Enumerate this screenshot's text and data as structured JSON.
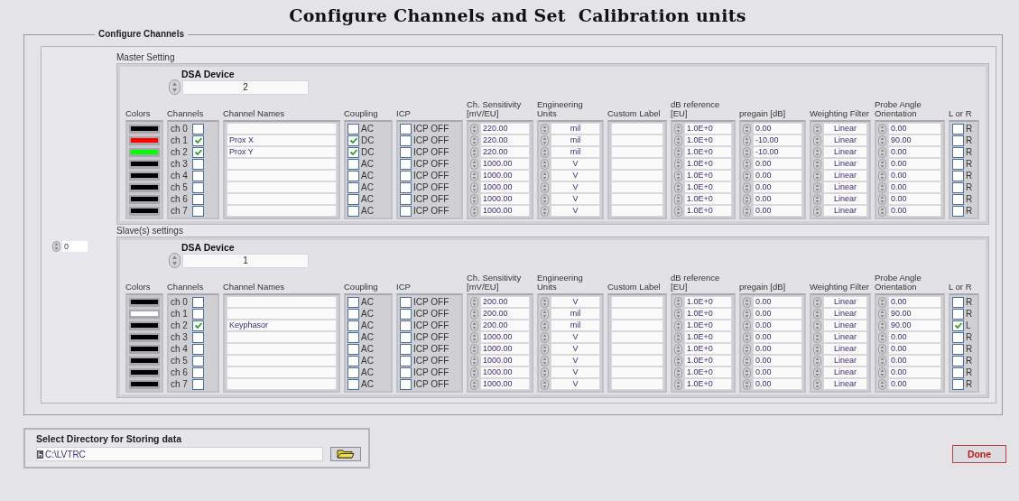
{
  "title": "Configure Channels and Set  Calibration units",
  "frame_label": "Configure Channels",
  "sections": [
    {
      "label": "Master Setting",
      "device_label": "DSA Device",
      "device": "2",
      "columns": [
        {
          "label": "Colors",
          "kind": "color"
        },
        {
          "label": "Channels",
          "kind": "channel"
        },
        {
          "label": "Channel Names",
          "kind": "name"
        },
        {
          "label": "Coupling",
          "kind": "coupling"
        },
        {
          "label": "ICP",
          "kind": "icp"
        },
        {
          "label": "Ch. Sensitivity [mV/EU]",
          "kind": "sensitivity"
        },
        {
          "label": "Engineering Units",
          "kind": "units"
        },
        {
          "label": "Custom Label",
          "kind": "custom"
        },
        {
          "label": "dB reference [EU]",
          "kind": "db_ref"
        },
        {
          "label": "pregain [dB]",
          "kind": "pregain"
        },
        {
          "label": "Weighting Filter",
          "kind": "filter"
        },
        {
          "label": "Probe Angle Orientation",
          "kind": "angle"
        },
        {
          "label": "L or R",
          "kind": "side"
        }
      ],
      "rows": [
        {
          "color": "#000000",
          "channel": "ch 0",
          "enabled": false,
          "coupling": {
            "checked": false,
            "label": "AC"
          },
          "icp": {
            "checked": false,
            "label": "ICP OFF"
          },
          "sensitivity": "220.00",
          "units": "mil",
          "db_ref": "1.0E+0",
          "pregain": "0.00",
          "filter": "Linear",
          "angle": "0.00",
          "side": {
            "checked": false,
            "label": "R"
          }
        },
        {
          "color": "#ff0000",
          "channel": "ch 1",
          "enabled": true,
          "name": "Prox X",
          "coupling": {
            "checked": true,
            "label": "DC"
          },
          "icp": {
            "checked": false,
            "label": "ICP OFF"
          },
          "sensitivity": "220.00",
          "units": "mil",
          "db_ref": "1.0E+0",
          "pregain": "-10.00",
          "filter": "Linear",
          "angle": "90.00",
          "side": {
            "checked": false,
            "label": "R"
          }
        },
        {
          "color": "#00ff00",
          "channel": "ch 2",
          "enabled": true,
          "name": "Prox Y",
          "coupling": {
            "checked": true,
            "label": "DC"
          },
          "icp": {
            "checked": false,
            "label": "ICP OFF"
          },
          "sensitivity": "220.00",
          "units": "mil",
          "db_ref": "1.0E+0",
          "pregain": "-10.00",
          "filter": "Linear",
          "angle": "0.00",
          "side": {
            "checked": false,
            "label": "R"
          }
        },
        {
          "color": "#000000",
          "channel": "ch 3",
          "enabled": false,
          "coupling": {
            "checked": false,
            "label": "AC"
          },
          "icp": {
            "checked": false,
            "label": "ICP OFF"
          },
          "sensitivity": "1000.00",
          "units": "V",
          "db_ref": "1.0E+0",
          "pregain": "0.00",
          "filter": "Linear",
          "angle": "0.00",
          "side": {
            "checked": false,
            "label": "R"
          }
        },
        {
          "color": "#000000",
          "channel": "ch 4",
          "enabled": false,
          "coupling": {
            "checked": false,
            "label": "AC"
          },
          "icp": {
            "checked": false,
            "label": "ICP OFF"
          },
          "sensitivity": "1000.00",
          "units": "V",
          "db_ref": "1.0E+0",
          "pregain": "0.00",
          "filter": "Linear",
          "angle": "0.00",
          "side": {
            "checked": false,
            "label": "R"
          }
        },
        {
          "color": "#000000",
          "channel": "ch 5",
          "enabled": false,
          "coupling": {
            "checked": false,
            "label": "AC"
          },
          "icp": {
            "checked": false,
            "label": "ICP OFF"
          },
          "sensitivity": "1000.00",
          "units": "V",
          "db_ref": "1.0E+0",
          "pregain": "0.00",
          "filter": "Linear",
          "angle": "0.00",
          "side": {
            "checked": false,
            "label": "R"
          }
        },
        {
          "color": "#000000",
          "channel": "ch 6",
          "enabled": false,
          "coupling": {
            "checked": false,
            "label": "AC"
          },
          "icp": {
            "checked": false,
            "label": "ICP OFF"
          },
          "sensitivity": "1000.00",
          "units": "V",
          "db_ref": "1.0E+0",
          "pregain": "0.00",
          "filter": "Linear",
          "angle": "0.00",
          "side": {
            "checked": false,
            "label": "R"
          }
        },
        {
          "color": "#000000",
          "channel": "ch 7",
          "enabled": false,
          "coupling": {
            "checked": false,
            "label": "AC"
          },
          "icp": {
            "checked": false,
            "label": "ICP OFF"
          },
          "sensitivity": "1000.00",
          "units": "V",
          "db_ref": "1.0E+0",
          "pregain": "0.00",
          "filter": "Linear",
          "angle": "0.00",
          "side": {
            "checked": false,
            "label": "R"
          }
        }
      ]
    },
    {
      "label": "Slave(s) settings",
      "count": "0",
      "device_label": "DSA Device",
      "device": "1",
      "columns": [
        {
          "label": "Colors",
          "kind": "color"
        },
        {
          "label": "Channels",
          "kind": "channel"
        },
        {
          "label": "Channel Names",
          "kind": "name"
        },
        {
          "label": "Coupling",
          "kind": "coupling"
        },
        {
          "label": "ICP",
          "kind": "icp"
        },
        {
          "label": "Ch. Sensitivity [mV/EU]",
          "kind": "sensitivity"
        },
        {
          "label": "Engineering Units",
          "kind": "units"
        },
        {
          "label": "Custom Label",
          "kind": "custom"
        },
        {
          "label": "dB reference [EU]",
          "kind": "db_ref"
        },
        {
          "label": "pregain [dB]",
          "kind": "pregain"
        },
        {
          "label": "Weighting Filter",
          "kind": "filter"
        },
        {
          "label": "Probe Angle Orientation",
          "kind": "angle"
        },
        {
          "label": "L or R",
          "kind": "side"
        }
      ],
      "rows": [
        {
          "color": "#000000",
          "channel": "ch 0",
          "enabled": false,
          "coupling": {
            "checked": false,
            "label": "AC"
          },
          "icp": {
            "checked": false,
            "label": "ICP OFF"
          },
          "sensitivity": "200.00",
          "units": "V",
          "db_ref": "1.0E+0",
          "pregain": "0.00",
          "filter": "Linear",
          "angle": "0.00",
          "side": {
            "checked": false,
            "label": "R"
          }
        },
        {
          "color": "#ffffff",
          "channel": "ch 1",
          "enabled": false,
          "coupling": {
            "checked": false,
            "label": "AC"
          },
          "icp": {
            "checked": false,
            "label": "ICP OFF"
          },
          "sensitivity": "200.00",
          "units": "mil",
          "db_ref": "1.0E+0",
          "pregain": "0.00",
          "filter": "Linear",
          "angle": "90.00",
          "side": {
            "checked": false,
            "label": "R"
          }
        },
        {
          "color": "#000000",
          "channel": "ch 2",
          "enabled": true,
          "name": "Keyphasor",
          "coupling": {
            "checked": false,
            "label": "AC"
          },
          "icp": {
            "checked": false,
            "label": "ICP OFF"
          },
          "sensitivity": "200.00",
          "units": "mil",
          "db_ref": "1.0E+0",
          "pregain": "0.00",
          "filter": "Linear",
          "angle": "90.00",
          "side": {
            "checked": true,
            "label": "L"
          }
        },
        {
          "color": "#000000",
          "channel": "ch 3",
          "enabled": false,
          "coupling": {
            "checked": false,
            "label": "AC"
          },
          "icp": {
            "checked": false,
            "label": "ICP OFF"
          },
          "sensitivity": "1000.00",
          "units": "V",
          "db_ref": "1.0E+0",
          "pregain": "0.00",
          "filter": "Linear",
          "angle": "0.00",
          "side": {
            "checked": false,
            "label": "R"
          }
        },
        {
          "color": "#000000",
          "channel": "ch 4",
          "enabled": false,
          "coupling": {
            "checked": false,
            "label": "AC"
          },
          "icp": {
            "checked": false,
            "label": "ICP OFF"
          },
          "sensitivity": "1000.00",
          "units": "V",
          "db_ref": "1.0E+0",
          "pregain": "0.00",
          "filter": "Linear",
          "angle": "0.00",
          "side": {
            "checked": false,
            "label": "R"
          }
        },
        {
          "color": "#000000",
          "channel": "ch 5",
          "enabled": false,
          "coupling": {
            "checked": false,
            "label": "AC"
          },
          "icp": {
            "checked": false,
            "label": "ICP OFF"
          },
          "sensitivity": "1000.00",
          "units": "V",
          "db_ref": "1.0E+0",
          "pregain": "0.00",
          "filter": "Linear",
          "angle": "0.00",
          "side": {
            "checked": false,
            "label": "R"
          }
        },
        {
          "color": "#000000",
          "channel": "ch 6",
          "enabled": false,
          "coupling": {
            "checked": false,
            "label": "AC"
          },
          "icp": {
            "checked": false,
            "label": "ICP OFF"
          },
          "sensitivity": "1000.00",
          "units": "V",
          "db_ref": "1.0E+0",
          "pregain": "0.00",
          "filter": "Linear",
          "angle": "0.00",
          "side": {
            "checked": false,
            "label": "R"
          }
        },
        {
          "color": "#000000",
          "channel": "ch 7",
          "enabled": false,
          "coupling": {
            "checked": false,
            "label": "AC"
          },
          "icp": {
            "checked": false,
            "label": "ICP OFF"
          },
          "sensitivity": "1000.00",
          "units": "V",
          "db_ref": "1.0E+0",
          "pregain": "0.00",
          "filter": "Linear",
          "angle": "0.00",
          "side": {
            "checked": false,
            "label": "R"
          }
        }
      ]
    }
  ],
  "directory": {
    "label": "Select Directory for Storing data",
    "value": "C:\\LVTRC"
  },
  "done_button": "Done"
}
